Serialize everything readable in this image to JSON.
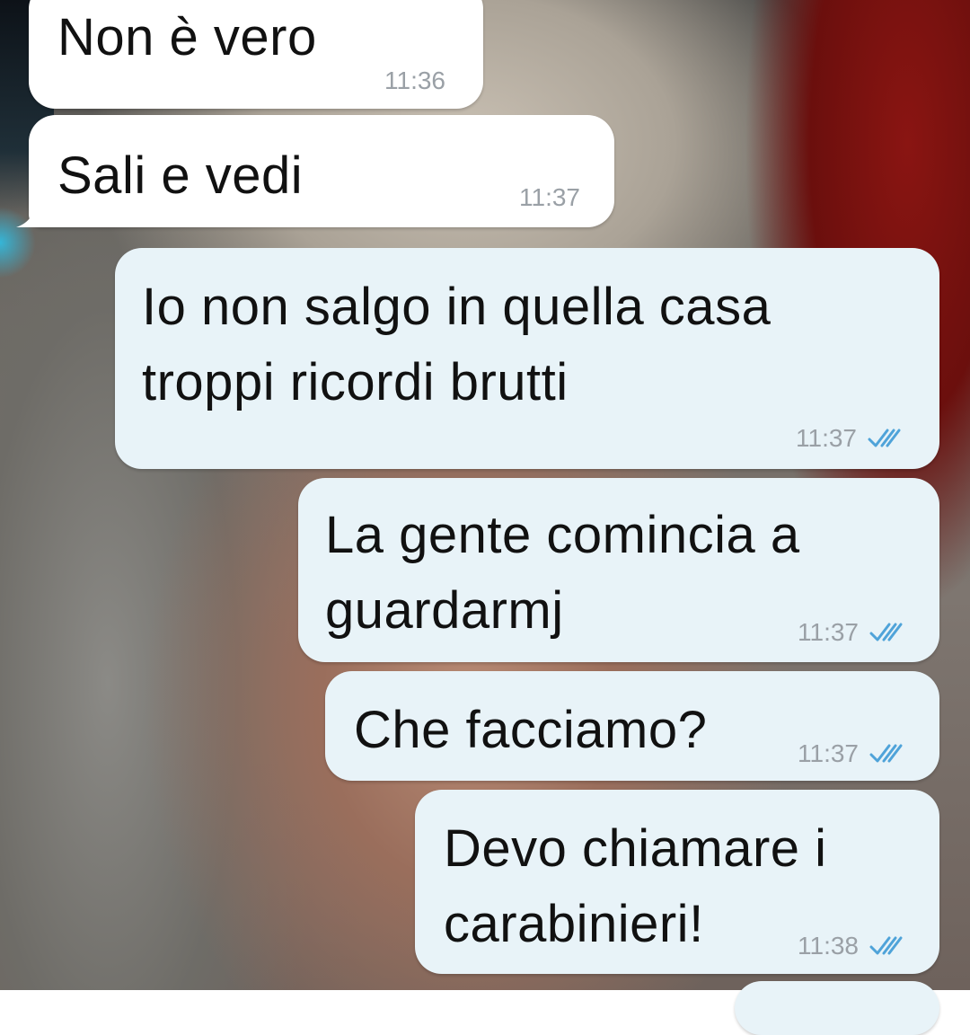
{
  "messages": [
    {
      "direction": "incoming",
      "text": "Non è vero",
      "time": "11:36"
    },
    {
      "direction": "incoming",
      "text": "Sali e vedi",
      "time": "11:37"
    },
    {
      "direction": "outgoing",
      "text": "Io non salgo in quella casa\ntroppi ricordi brutti",
      "time": "11:37",
      "status": "read",
      "status_icon": "double-check-icon"
    },
    {
      "direction": "outgoing",
      "text": "La gente comincia a\nguardarmj",
      "time": "11:37",
      "status": "read",
      "status_icon": "double-check-icon"
    },
    {
      "direction": "outgoing",
      "text": "Che facciamo?",
      "time": "11:37",
      "status": "read",
      "status_icon": "double-check-icon"
    },
    {
      "direction": "outgoing",
      "text": "Devo chiamare i\ncarabinieri!",
      "time": "11:38",
      "status": "read",
      "status_icon": "double-check-icon"
    }
  ],
  "colors": {
    "incoming_bubble": "#ffffff",
    "outgoing_bubble": "#e8f3f8",
    "time_text": "#9aa0a6",
    "read_check": "#4fa3d9"
  }
}
